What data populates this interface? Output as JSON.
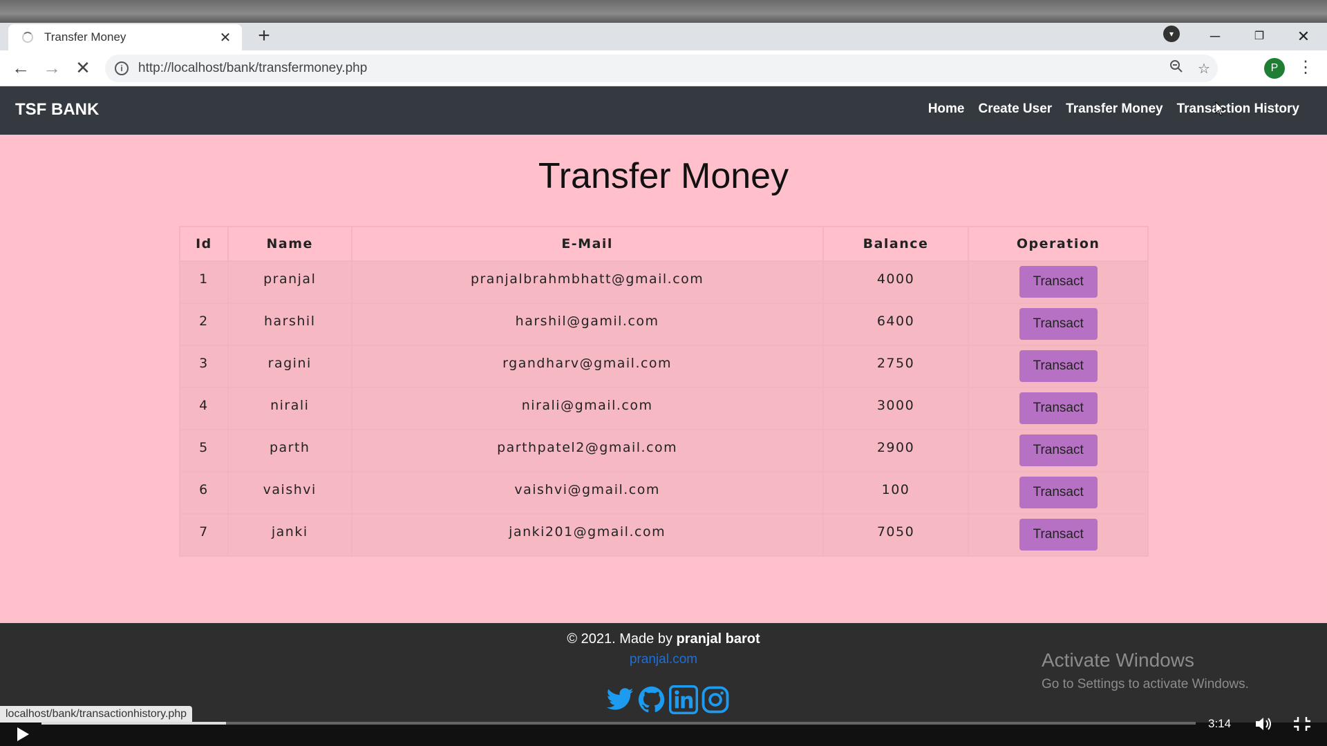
{
  "browser": {
    "tab_title": "Transfer Money",
    "tab_close": "✕",
    "new_tab": "+",
    "url": "http://localhost/bank/transfermoney.php",
    "profile_initial": "P"
  },
  "site": {
    "brand": "TSF BANK",
    "nav": [
      "Home",
      "Create User",
      "Transfer Money",
      "Transaction History"
    ]
  },
  "page": {
    "title": "Transfer Money",
    "table": {
      "headers": [
        "Id",
        "Name",
        "E-Mail",
        "Balance",
        "Operation"
      ],
      "rows": [
        {
          "id": "1",
          "name": "pranjal",
          "email": "pranjalbrahmbhatt@gmail.com",
          "balance": "4000",
          "action": "Transact"
        },
        {
          "id": "2",
          "name": "harshil",
          "email": "harshil@gamil.com",
          "balance": "6400",
          "action": "Transact"
        },
        {
          "id": "3",
          "name": "ragini",
          "email": "rgandharv@gmail.com",
          "balance": "2750",
          "action": "Transact"
        },
        {
          "id": "4",
          "name": "nirali",
          "email": "nirali@gmail.com",
          "balance": "3000",
          "action": "Transact"
        },
        {
          "id": "5",
          "name": "parth",
          "email": "parthpatel2@gmail.com",
          "balance": "2900",
          "action": "Transact"
        },
        {
          "id": "6",
          "name": "vaishvi",
          "email": "vaishvi@gmail.com",
          "balance": "100",
          "action": "Transact"
        },
        {
          "id": "7",
          "name": "janki",
          "email": "janki201@gmail.com",
          "balance": "7050",
          "action": "Transact"
        }
      ]
    }
  },
  "footer": {
    "copyright_prefix": "© 2021. Made by ",
    "author": "pranjal barot",
    "link": "pranjal.com",
    "social_icons": [
      "twitter-icon",
      "github-icon",
      "linkedin-icon",
      "instagram-icon"
    ]
  },
  "overlay": {
    "activate_title": "Activate Windows",
    "activate_sub": "Go to Settings to activate Windows.",
    "status_url": "localhost/bank/transactionhistory.php",
    "time": "3:14",
    "progress_fraction": 0.16
  },
  "colors": {
    "navbar": "#343a40",
    "page_bg": "#ffc0cb",
    "button": "#b771c4",
    "footer_bg": "#2e2e2e",
    "footer_link": "#1e6fd9"
  }
}
